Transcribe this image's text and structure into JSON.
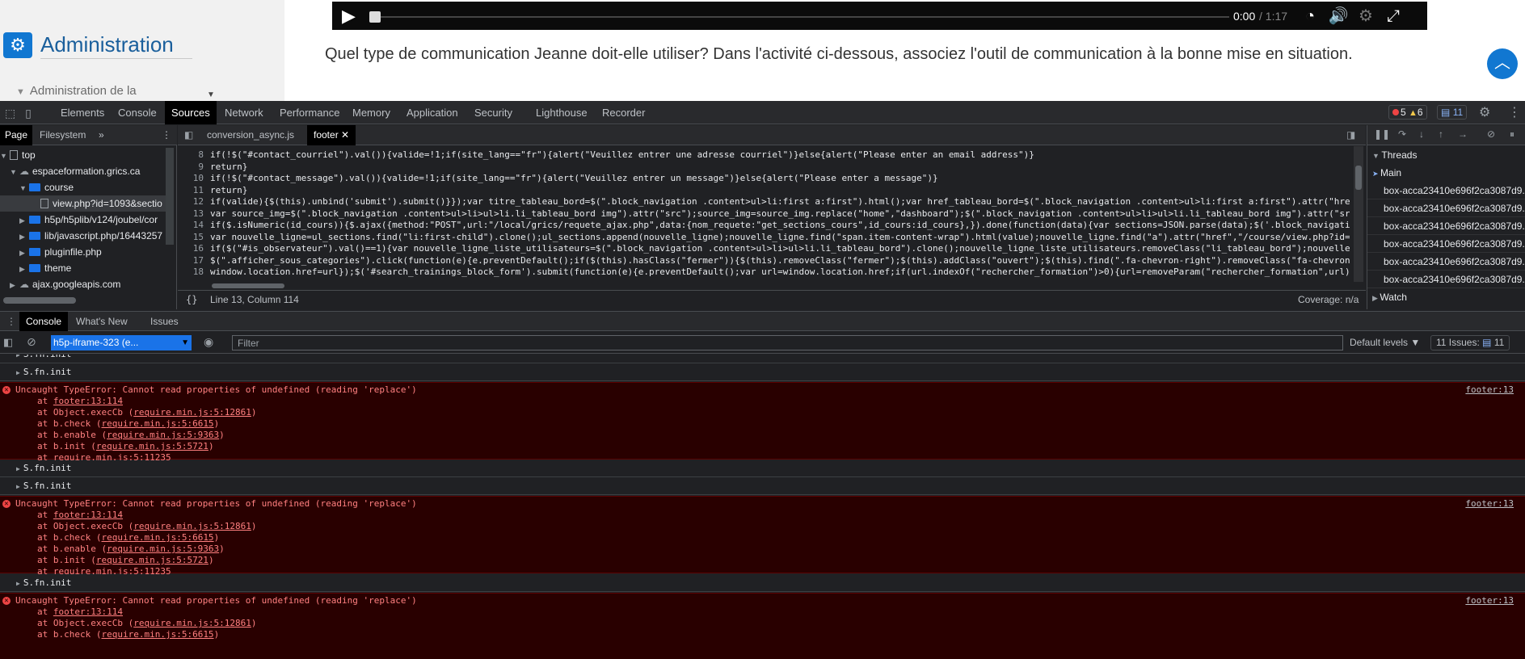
{
  "webpage": {
    "brand_title": "Administration",
    "admin_sub": "Administration de la",
    "video": {
      "time_current": "0:00",
      "time_total": "/ 1:17"
    },
    "question": "Quel type de communication Jeanne doit-elle utiliser? Dans l'activité ci-dessous, associez l'outil de communication à la bonne mise en situation."
  },
  "devtools": {
    "tabs": [
      "Elements",
      "Console",
      "Sources",
      "Network",
      "Performance",
      "Memory",
      "Application",
      "Security",
      "Lighthouse",
      "Recorder"
    ],
    "active_tab": "Sources",
    "errors_count": "5",
    "warnings_count": "6",
    "issues_count": "11"
  },
  "navigator": {
    "tabs": [
      "Page",
      "Filesystem"
    ],
    "more": "»",
    "tree": [
      {
        "label": "top",
        "depth": 0
      },
      {
        "label": "espaceformation.grics.ca",
        "depth": 1
      },
      {
        "label": "course",
        "depth": 2
      },
      {
        "label": "view.php?id=1093&sectio",
        "depth": 3
      },
      {
        "label": "h5p/h5plib/v124/joubel/cor",
        "depth": 2
      },
      {
        "label": "lib/javascript.php/16443257",
        "depth": 2
      },
      {
        "label": "pluginfile.php",
        "depth": 2
      },
      {
        "label": "theme",
        "depth": 2
      },
      {
        "label": "ajax.googleapis.com",
        "depth": 1
      }
    ]
  },
  "editor": {
    "tabs": [
      "conversion_async.js",
      "footer"
    ],
    "active_tab": "footer",
    "lines": [
      {
        "n": "8",
        "code": "if(!$(\"#contact_courriel\").val()){valide=!1;if(site_lang==\"fr\"){alert(\"Veuillez entrer une adresse courriel\")}else{alert(\"Please enter an email address\")}"
      },
      {
        "n": "9",
        "code": "return}"
      },
      {
        "n": "10",
        "code": "if(!$(\"#contact_message\").val()){valide=!1;if(site_lang==\"fr\"){alert(\"Veuillez entrer un message\")}else{alert(\"Please enter a message\")}"
      },
      {
        "n": "11",
        "code": "return}"
      },
      {
        "n": "12",
        "code": "if(valide){$(this).unbind('submit').submit()}});var titre_tableau_bord=$(\".block_navigation .content>ul>li:first a:first\").html();var href_tableau_bord=$(\".block_navigation .content>ul>li:first a:first\").attr(\"hre"
      },
      {
        "n": "13",
        "code": "var source_img=$(\".block_navigation .content>ul>li>ul>li.li_tableau_bord img\").attr(\"src\");source_img=source_img.replace(\"home\",\"dashboard\");$(\".block_navigation .content>ul>li>ul>li.li_tableau_bord img\").attr(\"sr"
      },
      {
        "n": "14",
        "code": "if($.isNumeric(id_cours)){$.ajax({method:\"POST\",url:\"/local/grics/requete_ajax.php\",data:{nom_requete:\"get_sections_cours\",id_cours:id_cours},}).done(function(data){var sections=JSON.parse(data);$('.block_navigati"
      },
      {
        "n": "15",
        "code": "var nouvelle_ligne=ul_sections.find(\"li:first-child\").clone();ul_sections.append(nouvelle_ligne);nouvelle_ligne.find(\"span.item-content-wrap\").html(value);nouvelle_ligne.find(\"a\").attr(\"href\",\"/course/view.php?id="
      },
      {
        "n": "16",
        "code": "if($(\"#is_observateur\").val()==1){var nouvelle_ligne_liste_utilisateurs=$(\".block_navigation .content>ul>li>ul>li.li_tableau_bord\").clone();nouvelle_ligne_liste_utilisateurs.removeClass(\"li_tableau_bord\");nouvelle_"
      },
      {
        "n": "17",
        "code": "$(\".afficher_sous_categories\").click(function(e){e.preventDefault();if($(this).hasClass(\"fermer\")){$(this).removeClass(\"fermer\");$(this).addClass(\"ouvert\");$(this).find(\".fa-chevron-right\").removeClass(\"fa-chevron"
      },
      {
        "n": "18",
        "code": "window.location.href=url});$('#search_trainings_block_form').submit(function(e){e.preventDefault();var url=window.location.href;if(url.indexOf(\"rechercher_formation\")>0){url=removeParam(\"rechercher_formation\",url)}"
      }
    ],
    "status_position": "Line 13, Column 114",
    "status_coverage": "Coverage: n/a",
    "braces": "{}"
  },
  "debugger": {
    "threads_label": "Threads",
    "main_label": "Main",
    "threads": [
      "box-acca23410e696f2ca3087d9...",
      "box-acca23410e696f2ca3087d9...",
      "box-acca23410e696f2ca3087d9...",
      "box-acca23410e696f2ca3087d9...",
      "box-acca23410e696f2ca3087d9...",
      "box-acca23410e696f2ca3087d9..."
    ],
    "watch_label": "Watch"
  },
  "console": {
    "tabs": [
      "Console",
      "What's New",
      "Issues"
    ],
    "active_tab": "Console",
    "context": "h5p-iframe-323 (e...",
    "filter_placeholder": "Filter",
    "levels": "Default levels ▼",
    "issues_label": "11 Issues:",
    "issues_count": "11",
    "info_text": "S.fn.init",
    "error_msg": "Uncaught TypeError: Cannot read properties of undefined (reading 'replace')",
    "error_src": "footer:13",
    "stack": [
      {
        "pre": "at ",
        "link": "footer:13:114",
        "post": ""
      },
      {
        "pre": "at Object.execCb (",
        "link": "require.min.js:5:12861",
        "post": ")"
      },
      {
        "pre": "at b.check (",
        "link": "require.min.js:5:6615",
        "post": ")"
      },
      {
        "pre": "at b.enable (",
        "link": "require.min.js:5:9363",
        "post": ")"
      },
      {
        "pre": "at b.init (",
        "link": "require.min.js:5:5721",
        "post": ")"
      },
      {
        "pre": "at ",
        "link": "require.min.js:5:11235",
        "post": ""
      }
    ]
  },
  "colors": {
    "accent": "#1a73e8",
    "error_bg": "#290000",
    "error_text": "#ff8080",
    "brand_blue": "#1177d1"
  }
}
